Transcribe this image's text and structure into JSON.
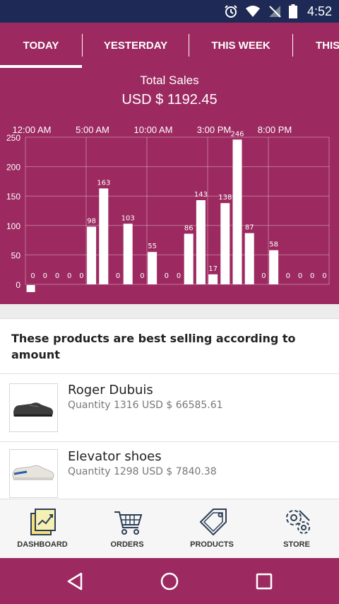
{
  "status_bar": {
    "time": "4:52"
  },
  "tabs": [
    {
      "label": "TODAY",
      "active": true
    },
    {
      "label": "YESTERDAY"
    },
    {
      "label": "THIS WEEK"
    },
    {
      "label": "THIS"
    }
  ],
  "sales": {
    "title": "Total Sales",
    "total": "USD $ 1192.45"
  },
  "chart_data": {
    "type": "bar",
    "x_ticks": [
      "12:00 AM",
      "5:00 AM",
      "10:00 AM",
      "3:00 PM",
      "8:00 PM"
    ],
    "y_ticks": [
      0,
      50,
      100,
      150,
      200,
      250
    ],
    "ylim": [
      0,
      250
    ],
    "grid": true,
    "values": [
      0,
      0,
      0,
      0,
      0,
      98,
      163,
      0,
      103,
      0,
      55,
      0,
      0,
      86,
      143,
      17,
      138,
      246,
      87,
      0,
      58,
      0,
      0,
      0,
      0
    ],
    "data_labels": [
      "0",
      "0",
      "0",
      "0",
      "0",
      "98",
      "163",
      "0",
      "103",
      "0",
      "55",
      "0",
      "0",
      "86",
      "143",
      "17",
      "138",
      "246",
      "87",
      "0",
      "58",
      "0",
      "0",
      "0",
      "0"
    ],
    "color": "#ffffff"
  },
  "best_selling": {
    "text": "These products are best selling according to amount"
  },
  "products": [
    {
      "name": "Roger Dubuis",
      "meta": "Quantity 1316 USD $ 66585.61"
    },
    {
      "name": "Elevator shoes",
      "meta": "Quantity 1298 USD $ 7840.38"
    }
  ],
  "bottom_nav": [
    {
      "label": "DASHBOARD",
      "icon": "dashboard-icon"
    },
    {
      "label": "ORDERS",
      "icon": "cart-icon"
    },
    {
      "label": "PRODUCTS",
      "icon": "tag-icon"
    },
    {
      "label": "STORE",
      "icon": "gear-wrench-icon"
    }
  ],
  "colors": {
    "primary": "#9c2a60",
    "status_bar": "#1e2a55"
  }
}
